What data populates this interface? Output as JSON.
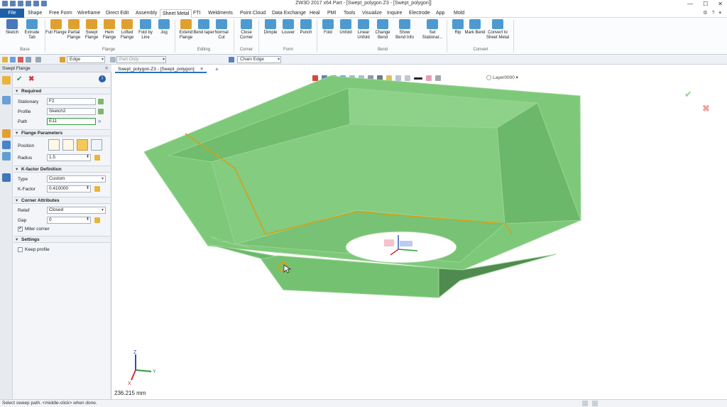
{
  "window": {
    "title": "ZW3D 2017 x64       Part - [Swept_polygon.Z3 - [Swept_polygon]]"
  },
  "menu": {
    "file": "File",
    "tabs": [
      "Shape",
      "Free Form",
      "Wireframe",
      "Direct Edit",
      "Assembly",
      "Sheet Metal",
      "FTI",
      "Weldments",
      "Point Cloud",
      "Data Exchange",
      "Heal",
      "PMI",
      "Tools",
      "Visualize",
      "Inquire",
      "Electrode",
      "App",
      "Mold"
    ],
    "active": "Sheet Metal"
  },
  "ribbon": {
    "buttons": [
      {
        "label": "Sketch",
        "color": "#4a78b8"
      },
      {
        "label": "Extrude Tab",
        "color": "#4e9ad0"
      },
      {
        "label": "Full Flange",
        "color": "#e0a030"
      },
      {
        "label": "Partial Flange",
        "color": "#e0a030"
      },
      {
        "label": "Swept Flange",
        "color": "#e0a030"
      },
      {
        "label": "Hem Flange",
        "color": "#e0a030"
      },
      {
        "label": "Lofted Flange",
        "color": "#e0a030"
      },
      {
        "label": "Fold by Line",
        "color": "#4e9ad0"
      },
      {
        "label": "Jog",
        "color": "#4e9ad0"
      },
      {
        "label": "Extend Flange",
        "color": "#e0a030"
      },
      {
        "label": "Bend taper",
        "color": "#4e9ad0"
      },
      {
        "label": "Normal Cut",
        "color": "#4e9ad0"
      },
      {
        "label": "Close Corner",
        "color": "#4e9ad0"
      },
      {
        "label": "Dimple",
        "color": "#4e9ad0"
      },
      {
        "label": "Louver",
        "color": "#4e9ad0"
      },
      {
        "label": "Punch",
        "color": "#4e9ad0"
      },
      {
        "label": "Fold",
        "color": "#4e9ad0"
      },
      {
        "label": "Unfold",
        "color": "#4e9ad0"
      },
      {
        "label": "Linear Unfold",
        "color": "#4e9ad0"
      },
      {
        "label": "Change Bend",
        "color": "#4e9ad0"
      },
      {
        "label": "Show Bend Info",
        "color": "#4e9ad0"
      },
      {
        "label": "Set Stationar...",
        "color": "#4e9ad0"
      },
      {
        "label": "Rip",
        "color": "#4e9ad0"
      },
      {
        "label": "Mark Bend",
        "color": "#4e9ad0"
      },
      {
        "label": "Convert to Sheet Metal",
        "color": "#4e9ad0"
      }
    ],
    "groups": [
      "Base",
      "Flange",
      "Editing",
      "Corner",
      "Form",
      "Bend",
      "Convert"
    ]
  },
  "toolbar2": {
    "filter": "Edge",
    "part": "Part Only",
    "chain": "Chain Edge"
  },
  "panel": {
    "title": "Swept Flange",
    "required": {
      "header": "Required",
      "stationary_label": "Stationary",
      "stationary": "F2",
      "profile_label": "Profile",
      "profile": "Sketch2",
      "path_label": "Path",
      "path": "E11"
    },
    "flange": {
      "header": "Flange Parameters",
      "position_label": "Position",
      "radius_label": "Radius",
      "radius": "1.5"
    },
    "kfactor": {
      "header": "K-factor Definition",
      "type_label": "Type",
      "type": "Custom",
      "k_label": "K-Factor",
      "k": "0.410000"
    },
    "corner": {
      "header": "Corner Attributes",
      "relief_label": "Relief",
      "relief": "Closed",
      "gap_label": "Gap",
      "gap": "0",
      "miter_label": "Miter corner",
      "miter_checked": true
    },
    "settings": {
      "header": "Settings",
      "keep_label": "Keep profile",
      "keep_checked": false
    }
  },
  "viewport": {
    "doc_tab": "Swept_polygon.Z3 - [Swept_polygon]",
    "layer": "Layer0000",
    "distance": "236.215 mm",
    "part_color": "#7ec87a",
    "path_color": "#d4a017"
  },
  "status": {
    "text": "Select sweep path.  <middle-click> when done."
  }
}
